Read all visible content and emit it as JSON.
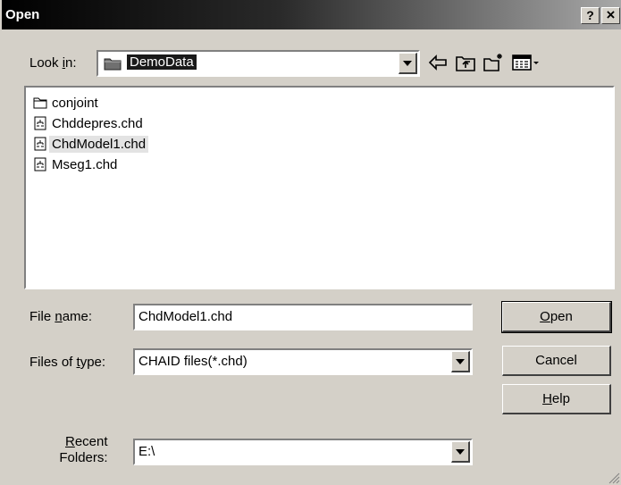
{
  "window": {
    "title": "Open",
    "help_glyph": "?",
    "close_glyph": "×"
  },
  "lookin": {
    "label_pre": "Look ",
    "label_hot": "i",
    "label_post": "n:",
    "value": "DemoData"
  },
  "toolbar": {
    "back_icon": "back-arrow-icon",
    "up_icon": "up-folder-icon",
    "newfolder_icon": "new-folder-icon",
    "views_icon": "views-menu-icon"
  },
  "files": [
    {
      "name": "conjoint",
      "type": "folder",
      "selected": false
    },
    {
      "name": "Chddepres.chd",
      "type": "file",
      "selected": false
    },
    {
      "name": "ChdModel1.chd",
      "type": "file",
      "selected": true
    },
    {
      "name": "Mseg1.chd",
      "type": "file",
      "selected": false
    }
  ],
  "filename": {
    "label_pre": "File ",
    "label_hot": "n",
    "label_post": "ame:",
    "value": "ChdModel1.chd"
  },
  "filetype": {
    "label_pre": "Files of ",
    "label_hot": "t",
    "label_post": "ype:",
    "value": "CHAID files(*.chd)"
  },
  "recent": {
    "label_hot": "R",
    "label_post": "ecent",
    "label_line2": "Folders:",
    "value": "E:\\"
  },
  "buttons": {
    "open_hot": "O",
    "open_rest": "pen",
    "cancel": "Cancel",
    "help_hot": "H",
    "help_rest": "elp"
  }
}
